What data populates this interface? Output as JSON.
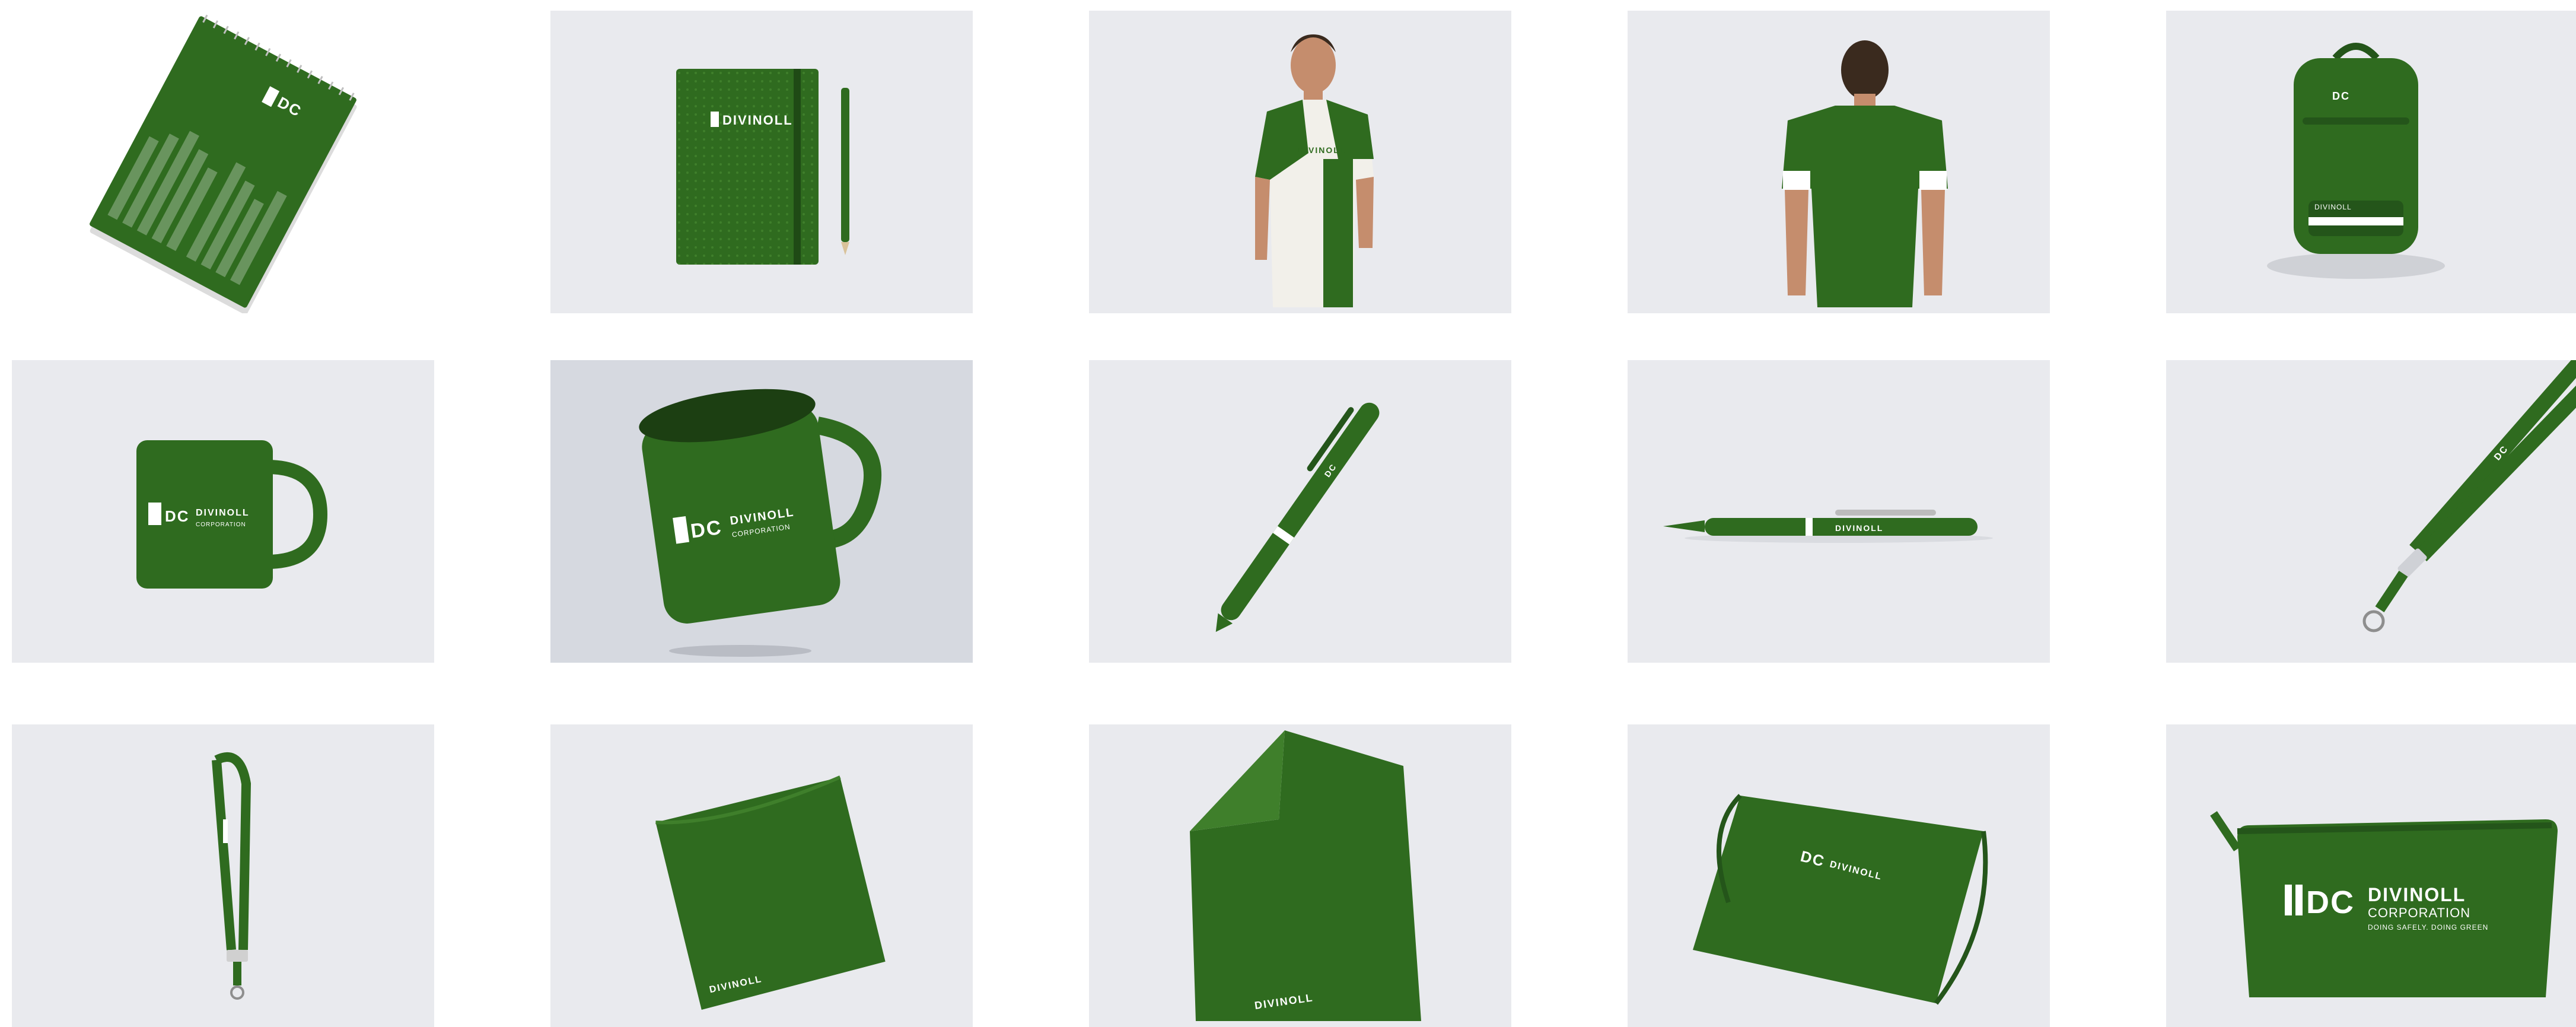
{
  "brand": {
    "monogram": "DC",
    "name": "DIVINOLL",
    "name_line2": "CORPORATION",
    "tagline": "DOING SAFELY. DOING GREEN",
    "bag_label": "DIVINOLL"
  },
  "colors": {
    "brand_green": "#2f6b1f",
    "dark_green": "#24551a",
    "light_green": "#3f7f2b",
    "white": "#ffffff",
    "tile_bg": "#e9eaee"
  },
  "items": [
    {
      "id": "notebook-spiral",
      "icon": "spiral-notebook"
    },
    {
      "id": "notebook-pencil",
      "icon": "notebook-with-pencil"
    },
    {
      "id": "tshirt-front",
      "icon": "tshirt-model-front"
    },
    {
      "id": "tshirt-back",
      "icon": "tshirt-model-back"
    },
    {
      "id": "backpack",
      "icon": "backpack"
    },
    {
      "id": "mug-flat",
      "icon": "mug"
    },
    {
      "id": "mug-floating",
      "icon": "mug-perspective"
    },
    {
      "id": "pen-diagonal",
      "icon": "ballpoint-pen"
    },
    {
      "id": "pen-horizontal",
      "icon": "ballpoint-pen"
    },
    {
      "id": "lanyard-diagonal",
      "icon": "lanyard"
    },
    {
      "id": "lanyard-hanging",
      "icon": "lanyard"
    },
    {
      "id": "cloth-square",
      "icon": "cleaning-cloth"
    },
    {
      "id": "cloth-folded",
      "icon": "folded-towel"
    },
    {
      "id": "drawstring-bag",
      "icon": "drawstring-bag"
    },
    {
      "id": "pouch",
      "icon": "zipper-pouch"
    }
  ]
}
